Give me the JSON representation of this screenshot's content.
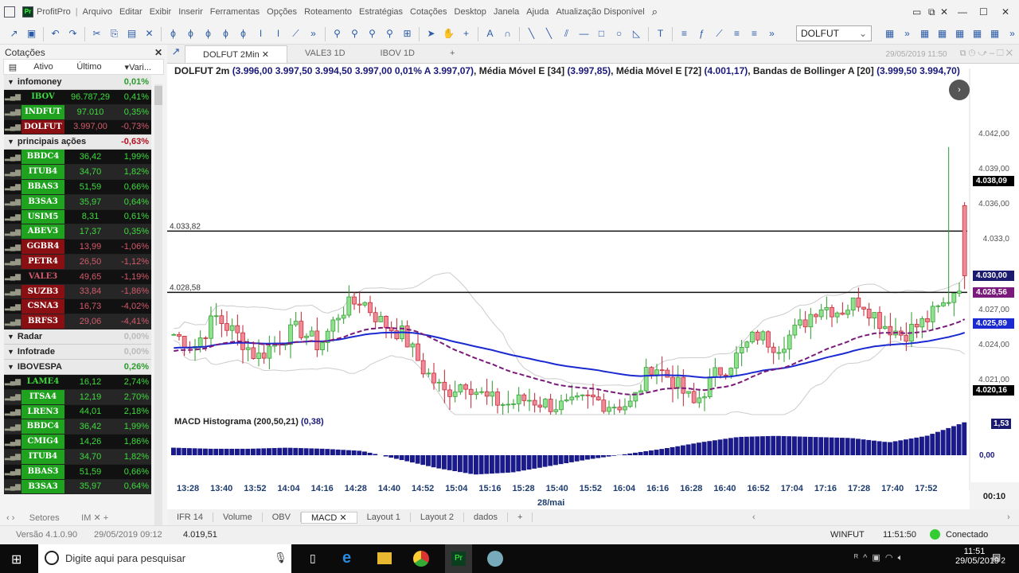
{
  "app": {
    "title": "ProfitPro",
    "menu": [
      "Arquivo",
      "Editar",
      "Exibir",
      "Inserir",
      "Ferramentas",
      "Opções",
      "Roteamento",
      "Estratégias",
      "Cotações",
      "Desktop",
      "Janela",
      "Ajuda",
      "Atualização Disponível"
    ]
  },
  "toolbar": {
    "symbol": "DOLFUT"
  },
  "quotes": {
    "title": "Cotações",
    "columns": [
      "Ativo",
      "Último",
      "Vari..."
    ],
    "groups": [
      {
        "name": "infomoney",
        "pct": "0,01%",
        "pos": true,
        "rows": [
          [
            "IBOV",
            "96.787,29",
            "0,41%",
            "g",
            ""
          ],
          [
            "INDFUT",
            "97.010",
            "0,35%",
            "g",
            "gb"
          ],
          [
            "DOLFUT",
            "3.997,00",
            "-0,73%",
            "r",
            "rb"
          ]
        ]
      },
      {
        "name": "principais ações",
        "pct": "-0,63%",
        "pos": false,
        "rows": [
          [
            "BBDC4",
            "36,42",
            "1,99%",
            "g",
            "gb"
          ],
          [
            "ITUB4",
            "34,70",
            "1,82%",
            "g",
            "gb"
          ],
          [
            "BBAS3",
            "51,59",
            "0,66%",
            "g",
            "gb"
          ],
          [
            "B3SA3",
            "35,97",
            "0,64%",
            "g",
            "gb"
          ],
          [
            "USIM5",
            "8,31",
            "0,61%",
            "g",
            "gb"
          ],
          [
            "ABEV3",
            "17,37",
            "0,35%",
            "g",
            "gb"
          ],
          [
            "GGBR4",
            "13,99",
            "-1,06%",
            "r",
            "rb"
          ],
          [
            "PETR4",
            "26,50",
            "-1,12%",
            "r",
            "rb"
          ],
          [
            "VALE3",
            "49,65",
            "-1,19%",
            "r",
            ""
          ],
          [
            "SUZB3",
            "33,84",
            "-1,86%",
            "r",
            "rb"
          ],
          [
            "CSNA3",
            "16,73",
            "-4,02%",
            "r",
            "rb"
          ],
          [
            "BRFS3",
            "29,06",
            "-4,41%",
            "r",
            "rb"
          ]
        ]
      },
      {
        "name": "Radar",
        "pct": "0,00%",
        "pos": null,
        "rows": []
      },
      {
        "name": "Infotrade",
        "pct": "0,00%",
        "pos": null,
        "rows": []
      },
      {
        "name": "IBOVESPA",
        "pct": "0,26%",
        "pos": true,
        "rows": [
          [
            "LAME4",
            "16,12",
            "2,74%",
            "g",
            ""
          ],
          [
            "ITSA4",
            "12,19",
            "2,70%",
            "g",
            "gb"
          ],
          [
            "LREN3",
            "44,01",
            "2,18%",
            "g",
            "gb"
          ],
          [
            "BBDC4",
            "36,42",
            "1,99%",
            "g",
            "gb"
          ],
          [
            "CMIG4",
            "14,26",
            "1,86%",
            "g",
            "gb"
          ],
          [
            "ITUB4",
            "34,70",
            "1,82%",
            "g",
            "gb"
          ],
          [
            "BBAS3",
            "51,59",
            "0,66%",
            "g",
            "gb"
          ],
          [
            "B3SA3",
            "35,97",
            "0,64%",
            "g",
            "gb"
          ]
        ]
      }
    ],
    "bottom_tabs": [
      "Setores",
      "IM"
    ],
    "version": "Versão 4.1.0.90",
    "version_date": "29/05/2019 09:12"
  },
  "chart": {
    "tabs": [
      "DOLFUT 2Min",
      "VALE3 1D",
      "IBOV 1D"
    ],
    "datetime": "29/05/2019 11:50",
    "legend": {
      "name": "DOLFUT 2m",
      "ohlc": "(3.996,00  3.997,50  3.994,50  3.997,00  0,01%  A 3.997,07)",
      "ma1": "Média Móvel E [34]",
      "ma1v": "(3.997,85)",
      "ma2": "Média Móvel E [72]",
      "ma2v": "(4.001,17)",
      "bb": "Bandas de Bollinger A [20]",
      "bbv": "(3.999,50  3.994,70)"
    },
    "y_ticks": [
      "4.042,00",
      "4.039,00",
      "4.036,00",
      "4.033,0",
      "4.027,00",
      "4.024,00",
      "4.021,00"
    ],
    "y_tick_values": [
      4042,
      4039,
      4036,
      4033,
      4027,
      4024,
      4021
    ],
    "hlines": [
      {
        "label": "4.033,82",
        "value": 4033.82
      },
      {
        "label": "4.028,58",
        "value": 4028.58
      }
    ],
    "tags": [
      {
        "label": "4.038,09",
        "value": 4038.09,
        "color": "#000000"
      },
      {
        "label": "4.030,00",
        "value": 4030.0,
        "color": "#1a1a6e"
      },
      {
        "label": "4.028,56",
        "value": 4028.56,
        "color": "#7a1a7a"
      },
      {
        "label": "4.025,89",
        "value": 4025.89,
        "color": "#1a2ad0"
      },
      {
        "label": "4.020,16",
        "value": 4020.16,
        "color": "#000000"
      }
    ],
    "keyprices": [
      4025,
      4024,
      4026.5,
      4025,
      4023,
      4024.5,
      4025.5,
      4024,
      4027,
      4028,
      4026,
      4025,
      4022,
      4020,
      4021,
      4019.5,
      4019,
      4019.5,
      4019,
      4018.8,
      4019.5,
      4019,
      4019,
      4022.5,
      4021,
      4019,
      4021.5,
      4023,
      4025,
      4024,
      4025.5,
      4027.5,
      4027,
      4028,
      4026,
      4025,
      4026,
      4027.5,
      4030
    ],
    "macd_label": "MACD Histograma (200,50,21)",
    "macd_value": "(0,38)",
    "macd_tag": "1,53",
    "macd_zero": "0,00",
    "macd_keys": [
      0.35,
      0.3,
      0.3,
      0.35,
      0.3,
      0.2,
      -0.2,
      -0.6,
      -0.9,
      -0.8,
      -0.5,
      -0.2,
      0.05,
      0.3,
      0.6,
      0.85,
      0.9,
      0.85,
      0.8,
      0.6,
      0.9,
      1.53
    ],
    "x_labels": [
      "13:28",
      "13:40",
      "13:52",
      "14:04",
      "14:16",
      "14:28",
      "14:40",
      "14:52",
      "15:04",
      "15:16",
      "15:28",
      "15:40",
      "15:52",
      "16:04",
      "16:16",
      "16:28",
      "16:40",
      "16:52",
      "17:04",
      "17:16",
      "17:28",
      "17:40",
      "17:52"
    ],
    "date_label": "28/mai",
    "countdown": "00:10",
    "bottom_tabs": [
      "IFR 14",
      "Volume",
      "OBV",
      "MACD",
      "Layout 1",
      "Layout 2",
      "dados"
    ]
  },
  "status": {
    "price": "4.019,51",
    "asset": "WINFUT",
    "time": "11:51:50",
    "conn": "Conectado"
  },
  "taskbar": {
    "search": "Digite aqui para pesquisar",
    "time": "11:51",
    "date": "29/05/2019",
    "notif": "2"
  }
}
